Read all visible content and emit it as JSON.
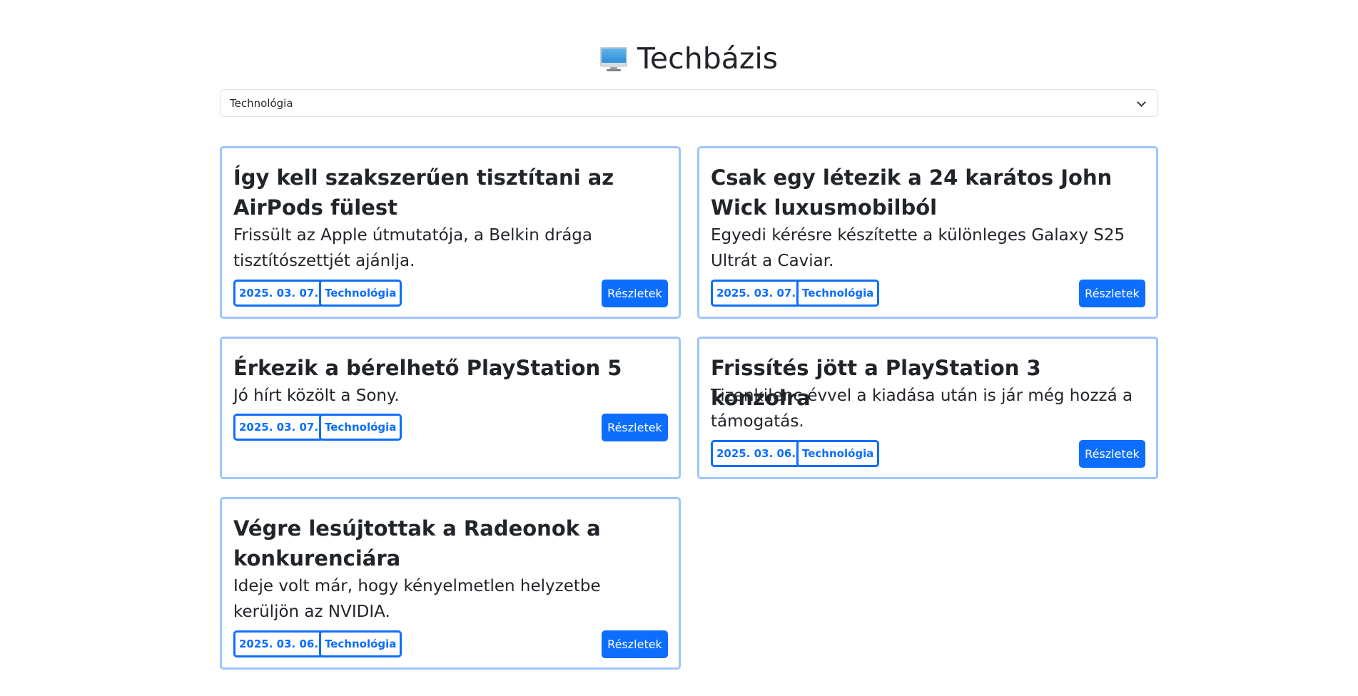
{
  "header": {
    "icon": "desktop-computer-icon",
    "title": "Techbázis"
  },
  "category_select": {
    "selected": "Technológia"
  },
  "articles": [
    {
      "title": "Így kell szakszerűen tisztítani az AirPods fülest",
      "description": "Frissült az Apple útmutatója, a Belkin drága tisztítószettjét ajánlja.",
      "date": "2025. 03. 07.",
      "category": "Technológia",
      "button": "Részletek"
    },
    {
      "title": "Csak egy létezik a 24 karátos John Wick luxusmobilból",
      "description": "Egyedi kérésre készítette a különleges Galaxy S25 Ultrát a Caviar.",
      "date": "2025. 03. 07.",
      "category": "Technológia",
      "button": "Részletek"
    },
    {
      "title": "Érkezik a bérelhető PlayStation 5",
      "description": "Jó hírt közölt a Sony.",
      "date": "2025. 03. 07.",
      "category": "Technológia",
      "button": "Részletek"
    },
    {
      "title": "Frissítés jött a PlayStation 3 konzolra",
      "description": "Tizenkilenc évvel a kiadása után is jár még hozzá a támogatás.",
      "date": "2025. 03. 06.",
      "category": "Technológia",
      "button": "Részletek"
    },
    {
      "title": "Végre lesújtottak a Radeonok a konkurenciára",
      "description": "Ideje volt már, hogy kényelmetlen helyzetbe kerüljön az NVIDIA.",
      "date": "2025. 03. 06.",
      "category": "Technológia",
      "button": "Részletek"
    }
  ],
  "colors": {
    "accent": "#0d6efd",
    "card_border": "#9ec5fe"
  }
}
